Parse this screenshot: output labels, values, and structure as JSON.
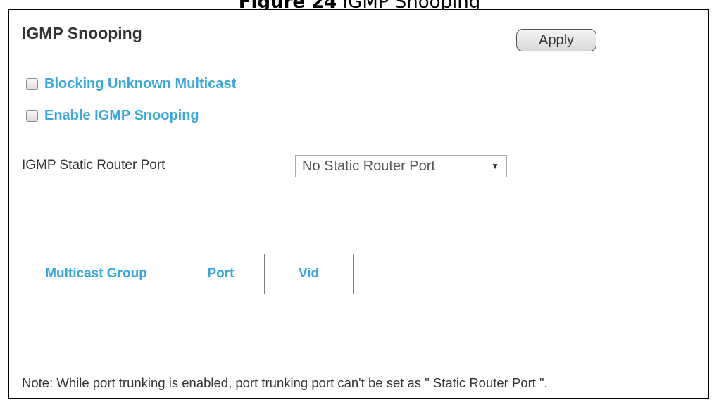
{
  "caption": {
    "figure_number": "Figure 24",
    "figure_title": "IGMP Snooping"
  },
  "panel": {
    "title": "IGMP Snooping",
    "apply_label": "Apply"
  },
  "options": [
    {
      "label": "Blocking Unknown Multicast",
      "checked": false
    },
    {
      "label": "Enable IGMP Snooping",
      "checked": false
    }
  ],
  "static_router_port": {
    "label": "IGMP Static Router Port",
    "selected": "No Static Router Port"
  },
  "table": {
    "columns": [
      "Multicast Group",
      "Port",
      "Vid"
    ],
    "rows": []
  },
  "note": "Note: While port trunking is enabled, port trunking port can't be set as \" Static Router Port \".",
  "colors": {
    "accent": "#3aa7dd",
    "text": "#333333",
    "border": "#7f7f7f"
  }
}
